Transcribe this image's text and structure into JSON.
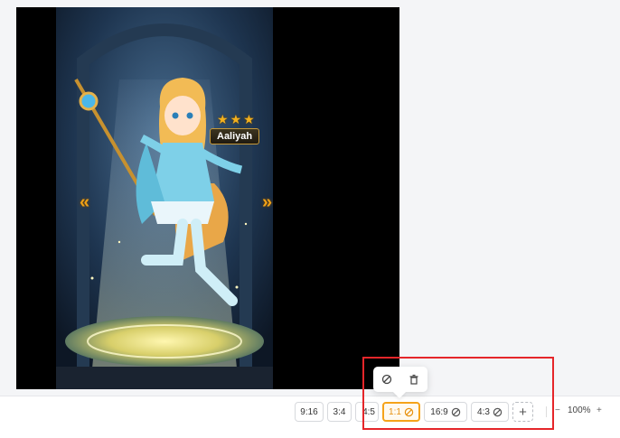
{
  "character": {
    "name": "Aaliyah",
    "stars": [
      "★",
      "★",
      "★"
    ]
  },
  "nav": {
    "prev_glyph": "«",
    "next_glyph": "»"
  },
  "aspect_ratios": [
    {
      "label": "9:16",
      "linked": false,
      "active": false
    },
    {
      "label": "3:4",
      "linked": false,
      "active": false
    },
    {
      "label": "4:5",
      "linked": false,
      "active": false
    },
    {
      "label": "1:1",
      "linked": true,
      "active": true
    },
    {
      "label": "16:9",
      "linked": true,
      "active": false
    },
    {
      "label": "4:3",
      "linked": true,
      "active": false
    }
  ],
  "add_ratio_label": "+",
  "zoom": {
    "minus": "−",
    "value": "100%",
    "plus": "+"
  },
  "popover": {
    "unlink_icon": "unlink-icon",
    "delete_icon": "trash-icon"
  },
  "colors": {
    "accent": "#f5a31a",
    "highlight": "#e5262a"
  }
}
